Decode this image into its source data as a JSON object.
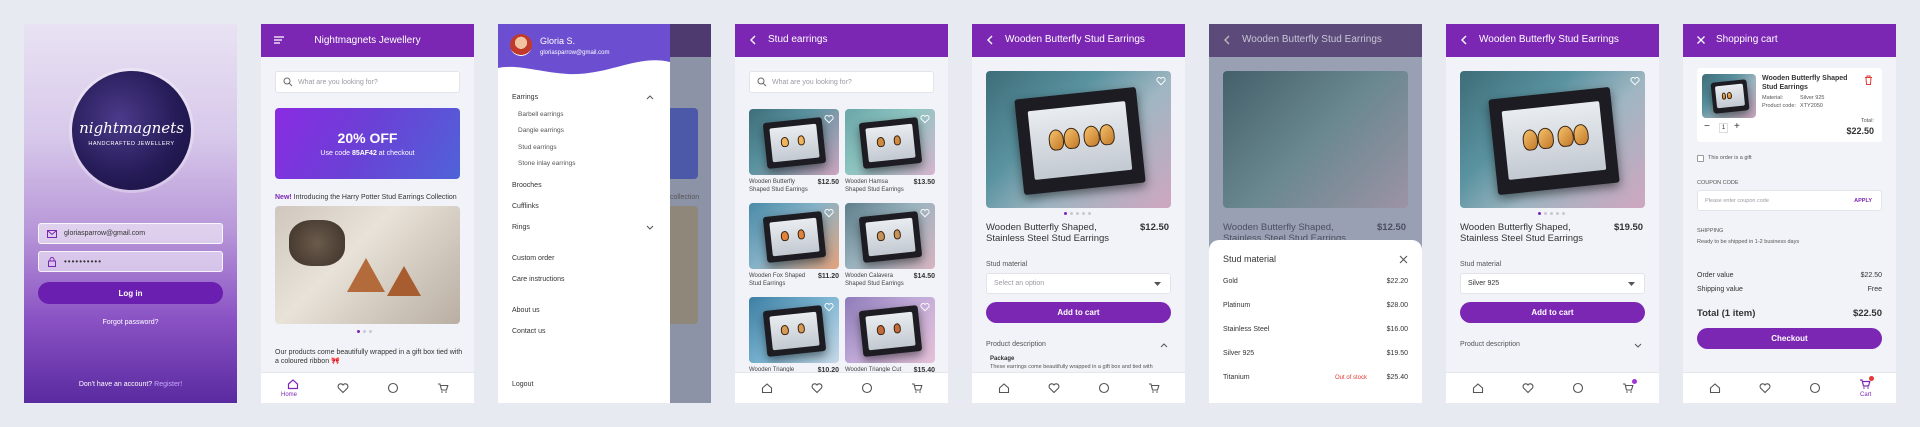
{
  "colors": {
    "brand": "#7b27b4",
    "accent": "#a336d6",
    "danger": "#e53935"
  },
  "login": {
    "logo_text": "nightmagnets",
    "logo_sub": "HANDCRAFTED JEWELLERY",
    "email": "gloriasparrow@gmail.com",
    "password": "••••••••••",
    "login_btn": "Log in",
    "forgot": "Forgot password?",
    "no_account": "Don't have an account?",
    "register": "Register!"
  },
  "home": {
    "title": "Nightmagnets Jewellery",
    "search_placeholder": "What are you looking for?",
    "promo_title": "20% OFF",
    "promo_sub_pre": "Use code ",
    "promo_code": "85AF42",
    "promo_sub_post": " at checkout",
    "new_label": "New!",
    "new_text": " Introducing the Harry Potter Stud Earrings Collection",
    "wrap_text": "Our products come beautifully wrapped in a gift box tied with a coloured ribbon 🎀",
    "nav_home": "Home"
  },
  "drawer": {
    "user_name": "Gloria S.",
    "user_email": "gloriasparrow@gmail.com",
    "earrings": "Earrings",
    "sub": [
      "Barbell earrings",
      "Dangle earrings",
      "Stud earrings",
      "Stone inlay earrings"
    ],
    "brooches": "Brooches",
    "cufflinks": "Cufflinks",
    "rings": "Rings",
    "custom": "Custom order",
    "care": "Care instructions",
    "about": "About us",
    "contact": "Contact us",
    "logout": "Logout",
    "bg_text": "collection"
  },
  "listing": {
    "title": "Stud earrings",
    "search_placeholder": "What are you looking for?",
    "items": [
      {
        "name": "Wooden Butterfly Shaped Stud Earrings",
        "price": "$12.50"
      },
      {
        "name": "Wooden Hamsa Shaped Stud Earrings",
        "price": "$13.50"
      },
      {
        "name": "Wooden Fox Shaped Stud Earrings",
        "price": "$11.20"
      },
      {
        "name": "Wooden Calavera Shaped Stud Earrings",
        "price": "$14.50"
      },
      {
        "name": "Wooden Triangle",
        "price": "$10.20"
      },
      {
        "name": "Wooden Triangle Cut",
        "price": "$15.40"
      }
    ]
  },
  "product": {
    "title": "Wooden Butterfly Stud Earrings",
    "name": "Wooden Butterfly Shaped, Stainless Steel Stud Earrings",
    "price": "$12.50",
    "price_selected": "$19.50",
    "material_label": "Stud material",
    "select_placeholder": "Select an option",
    "selected": "Silver 925",
    "add_to_cart": "Add to cart",
    "desc_label": "Product description",
    "package_label": "Package",
    "package_text": "These earrings come beautifully wrapped in a gift box and tied with"
  },
  "sheet": {
    "title": "Stud material",
    "rows": [
      {
        "name": "Gold",
        "price": "$22.20",
        "note": ""
      },
      {
        "name": "Platinum",
        "price": "$28.00",
        "note": ""
      },
      {
        "name": "Stainless Steel",
        "price": "$16.00",
        "note": ""
      },
      {
        "name": "Silver 925",
        "price": "$19.50",
        "note": ""
      },
      {
        "name": "Titanium",
        "price": "$25.40",
        "note": "Out of stock"
      }
    ]
  },
  "cart": {
    "title": "Shopping cart",
    "item_name": "Wooden Butterfly Shaped Stud Earrings",
    "material_label": "Material:",
    "material_val": "Silver 925",
    "code_label": "Product code:",
    "code_val": "XTY2050",
    "qty": "1",
    "total_label": "Total:",
    "total": "$22.50",
    "gift": "This order is a gift",
    "coupon_label": "COUPON CODE",
    "coupon_placeholder": "Please enter coupon code",
    "apply": "APPLY",
    "shipping_label": "SHIPPING",
    "shipping_text": "Ready to be shipped in 1-2 business days",
    "order_value_label": "Order value",
    "order_value": "$22.50",
    "shipping_value_label": "Shipping value",
    "shipping_value": "Free",
    "grand_label": "Total (1 item)",
    "grand": "$22.50",
    "checkout": "Checkout",
    "nav_cart": "Cart"
  }
}
